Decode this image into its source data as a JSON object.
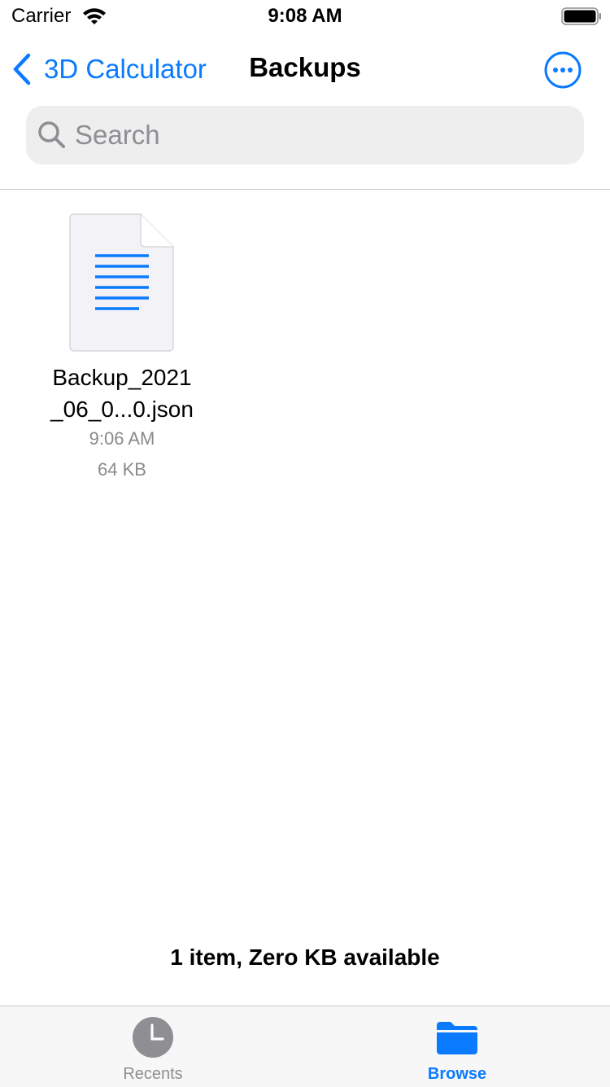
{
  "status_bar": {
    "carrier": "Carrier",
    "time": "9:08 AM"
  },
  "nav": {
    "back_label": "3D Calculator",
    "title": "Backups"
  },
  "search": {
    "placeholder": "Search",
    "value": ""
  },
  "files": [
    {
      "name": "Backup_2021\n_06_0...0.json",
      "time": "9:06 AM",
      "size": "64 KB",
      "icon": "document-icon"
    }
  ],
  "footer": {
    "item_count": "1 item, Zero KB available"
  },
  "tabs": [
    {
      "label": "Recents",
      "icon": "clock-icon",
      "selected": false
    },
    {
      "label": "Browse",
      "icon": "folder-icon",
      "selected": true
    }
  ],
  "colors": {
    "accent": "#0a7aff",
    "secondary_text": "#8a8a8e",
    "search_bg": "#eeeeef",
    "tabbar_bg": "#f7f7f7"
  }
}
